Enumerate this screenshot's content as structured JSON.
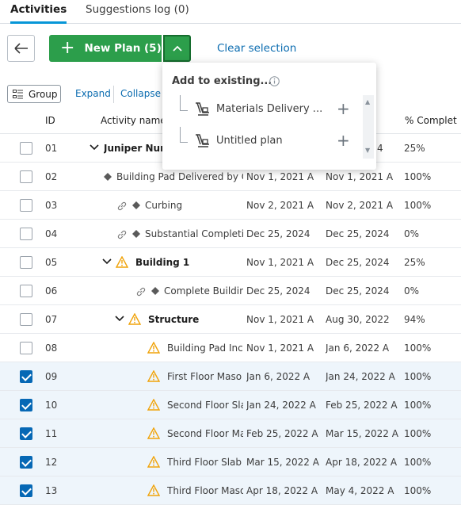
{
  "tabs": [
    {
      "label": "Activities"
    },
    {
      "label": "Suggestions log (0)"
    }
  ],
  "toolbar": {
    "new_plan_label": "New Plan (5)",
    "clear_selection": "Clear selection"
  },
  "subtoolbar": {
    "group": "Group",
    "expand": "Expand",
    "collapse": "Collapse"
  },
  "dropdown": {
    "title": "Add to existing...",
    "items": [
      {
        "label": "Materials Delivery ..."
      },
      {
        "label": "Untitled plan"
      }
    ]
  },
  "table": {
    "headers": {
      "id": "ID",
      "name": "Activity name",
      "pct": "% Complet"
    },
    "rows": [
      {
        "id": "01",
        "name": "Juniper Nurs",
        "start": "",
        "finish": "4",
        "pct": "25%",
        "checked": false
      },
      {
        "id": "02",
        "name": "Building Pad Delivered by O",
        "start": "Nov 1, 2021 A",
        "finish": "Nov 1, 2021 A",
        "pct": "100%",
        "checked": false
      },
      {
        "id": "03",
        "name": "Curbing",
        "start": "Nov 2, 2021 A",
        "finish": "Nov 2, 2021 A",
        "pct": "100%",
        "checked": false
      },
      {
        "id": "04",
        "name": "Substantial Completi",
        "start": "Dec 25, 2024",
        "finish": "Dec 25, 2024",
        "pct": "0%",
        "checked": false
      },
      {
        "id": "05",
        "name": "Building 1",
        "start": "Nov 1, 2021 A",
        "finish": "Dec 25, 2024",
        "pct": "25%",
        "checked": false
      },
      {
        "id": "06",
        "name": "Complete Buildin",
        "start": "Dec 25, 2024",
        "finish": "Dec 25, 2024",
        "pct": "0%",
        "checked": false
      },
      {
        "id": "07",
        "name": "Structure",
        "start": "Nov 1, 2021 A",
        "finish": "Aug 30, 2022",
        "pct": "94%",
        "checked": false
      },
      {
        "id": "08",
        "name": "Building Pad Inc",
        "start": "Nov 1, 2021 A",
        "finish": "Jan 6, 2022 A",
        "pct": "100%",
        "checked": false
      },
      {
        "id": "09",
        "name": "First Floor Maso",
        "start": "Jan 6, 2022 A",
        "finish": "Jan 24, 2022 A",
        "pct": "100%",
        "checked": true
      },
      {
        "id": "10",
        "name": "Second Floor Sla",
        "start": "Jan 24, 2022 A",
        "finish": "Feb 25, 2022 A",
        "pct": "100%",
        "checked": true
      },
      {
        "id": "11",
        "name": "Second Floor Ma",
        "start": "Feb 25, 2022 A",
        "finish": "Mar 15, 2022 A",
        "pct": "100%",
        "checked": true
      },
      {
        "id": "12",
        "name": "Third Floor Slab",
        "start": "Mar 15, 2022 A",
        "finish": "Apr 18, 2022 A",
        "pct": "100%",
        "checked": true
      },
      {
        "id": "13",
        "name": "Third Floor Maso",
        "start": "Apr 18, 2022 A",
        "finish": "May 4, 2022 A",
        "pct": "100%",
        "checked": true
      }
    ]
  },
  "colors": {
    "accent": "#2c9e4b",
    "link": "#0b6cb0",
    "checkbox": "#0668b5",
    "warning": "#f0a30a"
  },
  "icons": [
    "back-arrow-icon",
    "plus-icon",
    "chevron-up-icon",
    "group-icon",
    "info-icon",
    "plan-icon",
    "chevron-down-icon",
    "diamond-icon",
    "link-icon",
    "warning-icon"
  ]
}
